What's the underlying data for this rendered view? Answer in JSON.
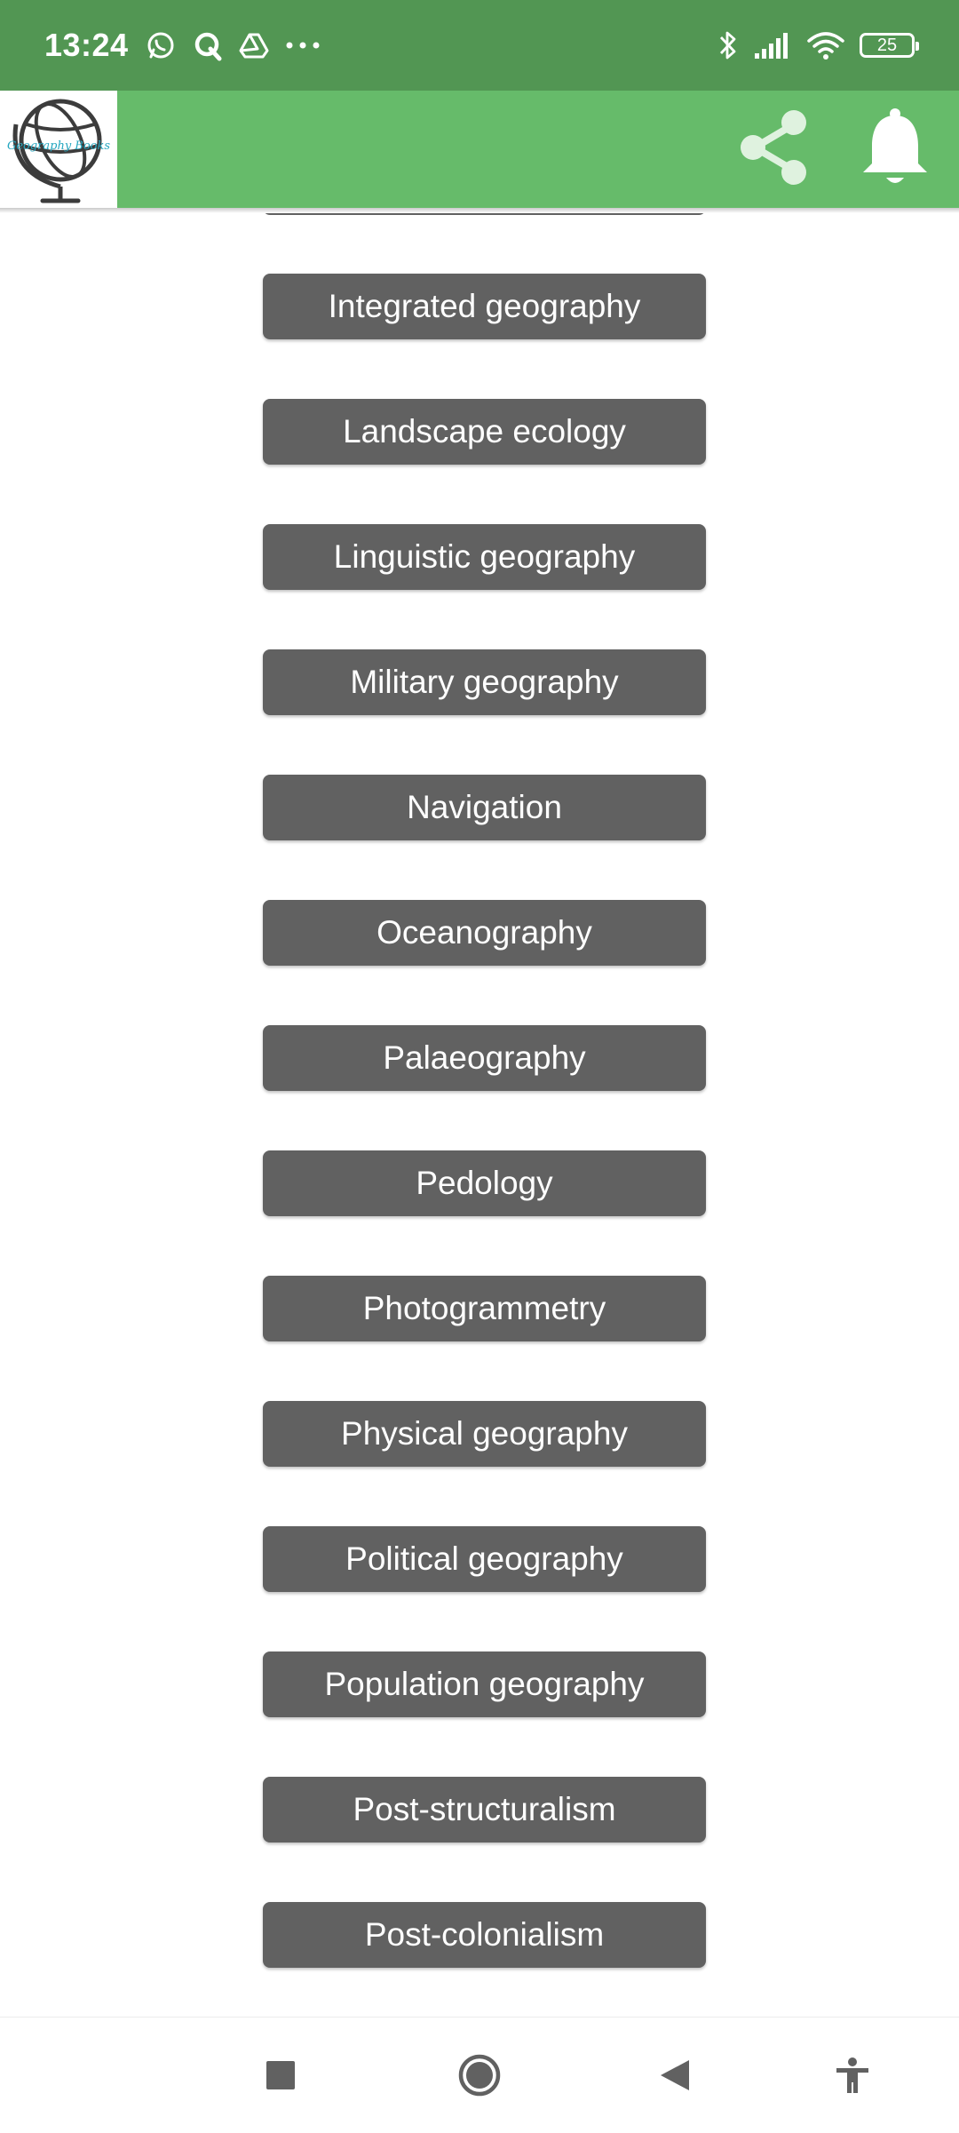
{
  "status_bar": {
    "time": "13:24",
    "battery_level": "25",
    "icons": [
      "whatsapp-icon",
      "q-icon",
      "drive-icon",
      "more-dots-icon",
      "bluetooth-icon",
      "signal-icon",
      "wifi-icon",
      "battery-icon"
    ]
  },
  "app_bar": {
    "logo_text": "Geography Books",
    "icons": [
      "share-icon",
      "notification-bell-icon"
    ]
  },
  "topics": [
    "Integrated geography",
    "Landscape ecology",
    "Linguistic geography",
    "Military geography",
    "Navigation",
    "Oceanography",
    "Palaeography",
    "Pedology",
    "Photogrammetry",
    "Physical geography",
    "Political geography",
    "Population geography",
    "Post-structuralism",
    "Post-colonialism"
  ],
  "nav_bar": {
    "icons": [
      "recents-square-icon",
      "home-circle-icon",
      "back-triangle-icon",
      "accessibility-icon"
    ]
  },
  "colors": {
    "status_bar": "#529653",
    "app_bar": "#66bb6a",
    "button": "#616161",
    "button_text": "#ffffff",
    "nav_icon": "#616161"
  }
}
